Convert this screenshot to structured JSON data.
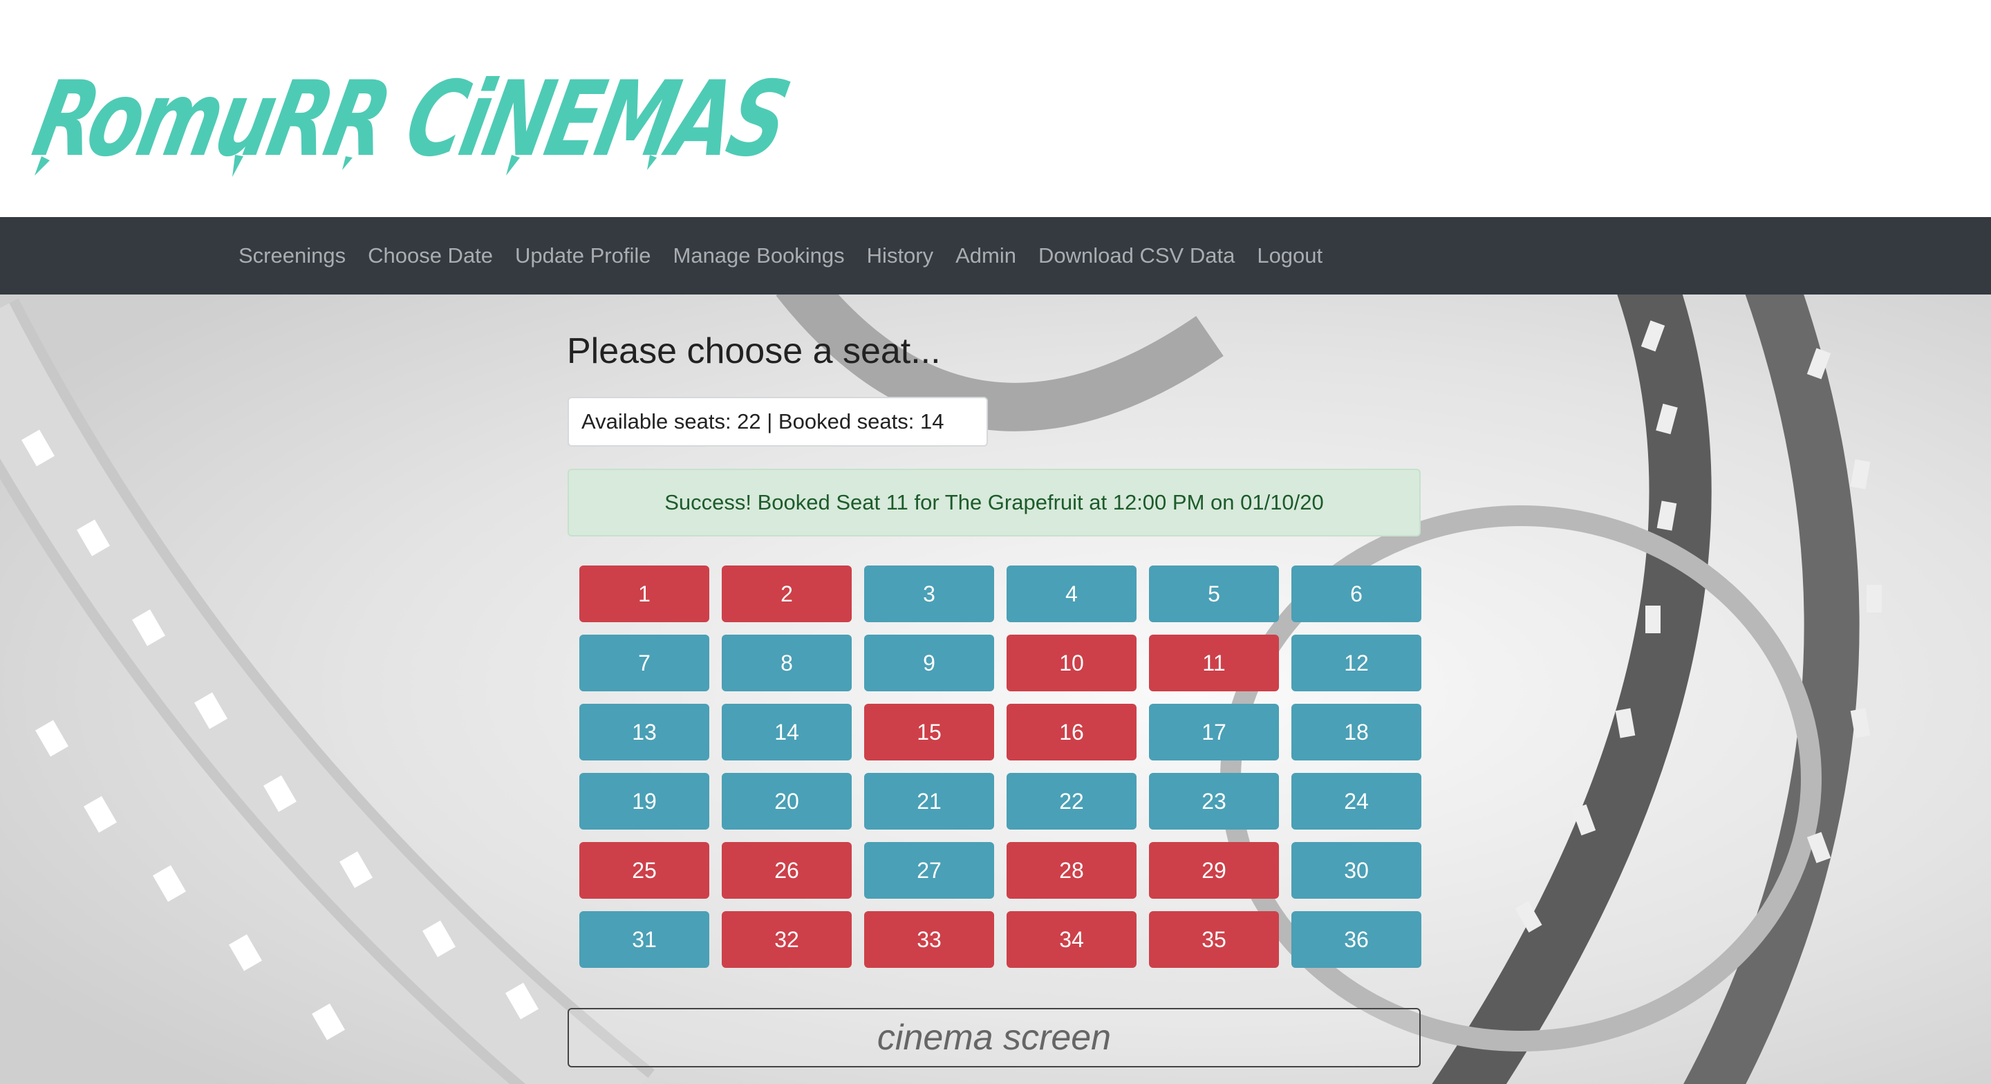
{
  "brand": {
    "logo_text": "RomuRR CiNEMAS",
    "logo_color": "#4ecbb5"
  },
  "nav": {
    "items": [
      {
        "label": "Screenings"
      },
      {
        "label": "Choose Date"
      },
      {
        "label": "Update Profile"
      },
      {
        "label": "Manage Bookings"
      },
      {
        "label": "History"
      },
      {
        "label": "Admin"
      },
      {
        "label": "Download CSV Data"
      },
      {
        "label": "Logout"
      }
    ]
  },
  "main": {
    "title": "Please choose a seat...",
    "seat_stats": "Available seats: 22 | Booked seats: 14",
    "alert": "Success! Booked Seat 11 for The Grapefruit at 12:00 PM on 01/10/20",
    "screen_label": "cinema screen"
  },
  "seats": [
    {
      "number": "1",
      "status": "booked"
    },
    {
      "number": "2",
      "status": "booked"
    },
    {
      "number": "3",
      "status": "available"
    },
    {
      "number": "4",
      "status": "available"
    },
    {
      "number": "5",
      "status": "available"
    },
    {
      "number": "6",
      "status": "available"
    },
    {
      "number": "7",
      "status": "available"
    },
    {
      "number": "8",
      "status": "available"
    },
    {
      "number": "9",
      "status": "available"
    },
    {
      "number": "10",
      "status": "booked"
    },
    {
      "number": "11",
      "status": "booked"
    },
    {
      "number": "12",
      "status": "available"
    },
    {
      "number": "13",
      "status": "available"
    },
    {
      "number": "14",
      "status": "available"
    },
    {
      "number": "15",
      "status": "booked"
    },
    {
      "number": "16",
      "status": "booked"
    },
    {
      "number": "17",
      "status": "available"
    },
    {
      "number": "18",
      "status": "available"
    },
    {
      "number": "19",
      "status": "available"
    },
    {
      "number": "20",
      "status": "available"
    },
    {
      "number": "21",
      "status": "available"
    },
    {
      "number": "22",
      "status": "available"
    },
    {
      "number": "23",
      "status": "available"
    },
    {
      "number": "24",
      "status": "available"
    },
    {
      "number": "25",
      "status": "booked"
    },
    {
      "number": "26",
      "status": "booked"
    },
    {
      "number": "27",
      "status": "available"
    },
    {
      "number": "28",
      "status": "booked"
    },
    {
      "number": "29",
      "status": "booked"
    },
    {
      "number": "30",
      "status": "available"
    },
    {
      "number": "31",
      "status": "available"
    },
    {
      "number": "32",
      "status": "booked"
    },
    {
      "number": "33",
      "status": "booked"
    },
    {
      "number": "34",
      "status": "booked"
    },
    {
      "number": "35",
      "status": "booked"
    },
    {
      "number": "36",
      "status": "available"
    }
  ],
  "colors": {
    "booked": "#cd4049",
    "available": "#4aa0b6",
    "navbar": "#343a40",
    "alert_bg": "#d8eadb",
    "alert_text": "#1c5b2b"
  }
}
